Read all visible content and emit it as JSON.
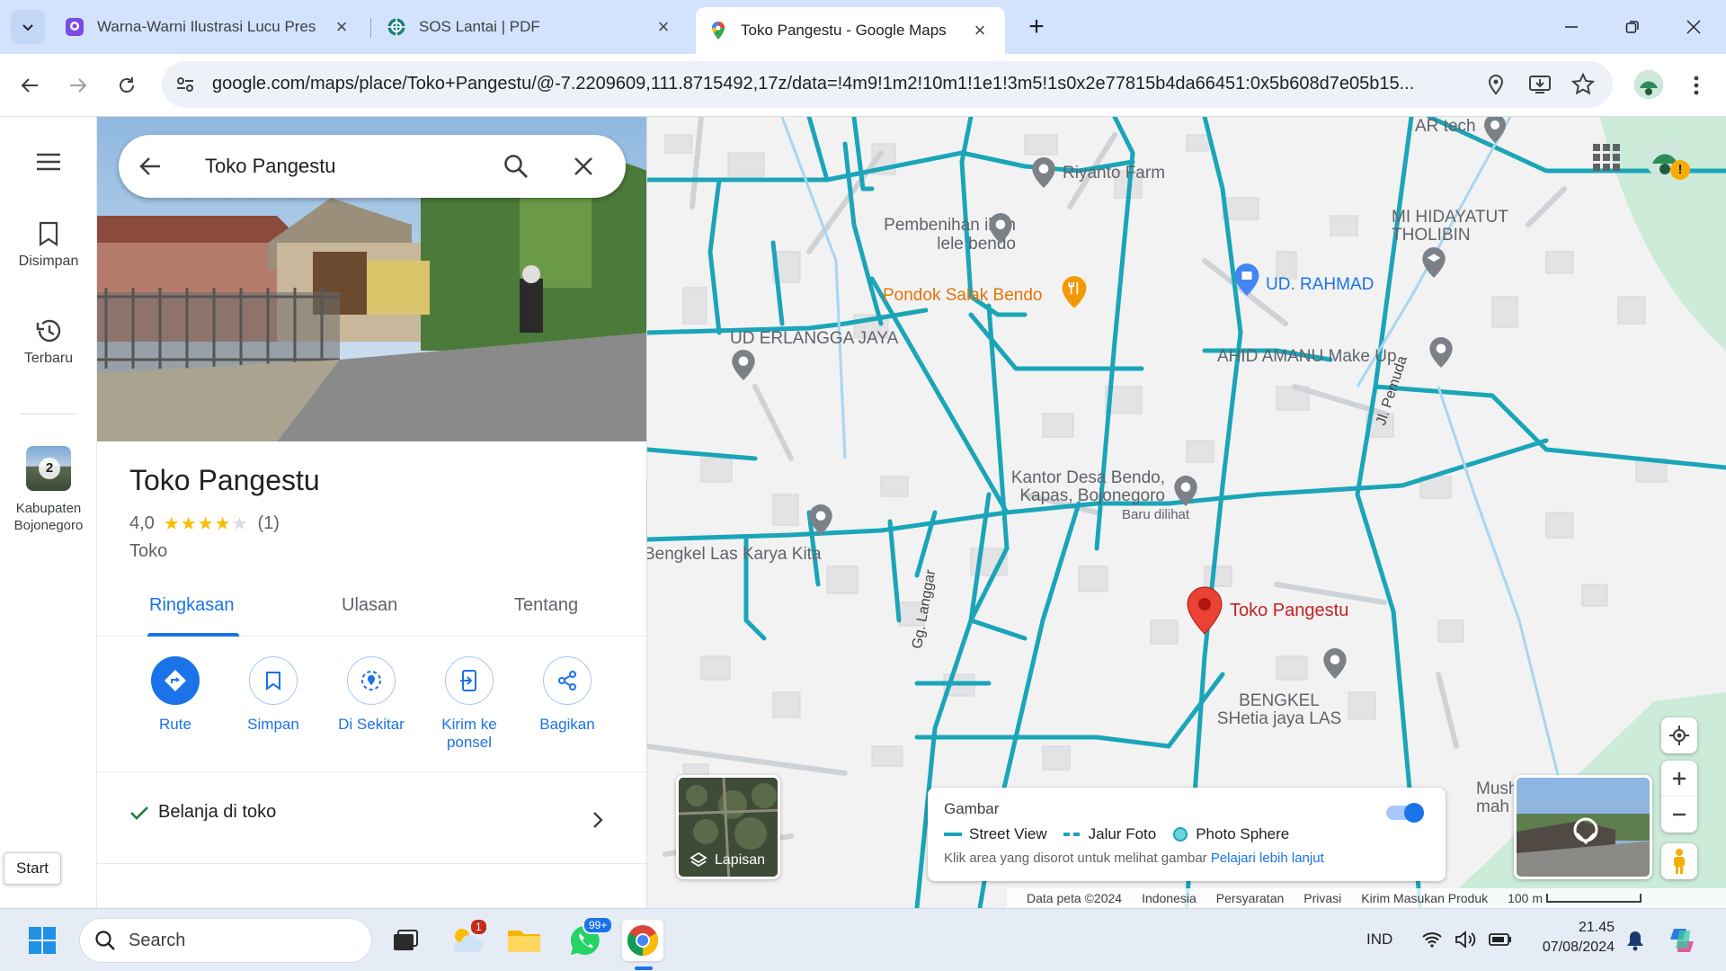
{
  "browser": {
    "tabs": [
      {
        "title": "Warna-Warni Ilustrasi Lucu Pres",
        "icon": "canva-icon"
      },
      {
        "title": "SOS Lantai | PDF",
        "icon": "globe-icon"
      },
      {
        "title": "Toko Pangestu - Google Maps",
        "icon": "maps-pin-icon",
        "active": true
      }
    ],
    "new_tab": "+",
    "url": "google.com/maps/place/Toko+Pangestu/@-7.2209609,111.8715492,17z/data=!4m9!1m2!10m1!1e1!3m5!1s0x2e77815b4da66451:0x5b608d7e05b15..."
  },
  "rail": {
    "saved": "Disimpan",
    "recent": "Terbaru",
    "recent_place": "Kabupaten Bojonegoro",
    "recent_count": "2"
  },
  "search": {
    "value": "Toko Pangestu"
  },
  "place": {
    "name": "Toko Pangestu",
    "rating": "4,0",
    "stars": 4,
    "reviews": "(1)",
    "category": "Toko"
  },
  "panel_tabs": [
    "Ringkasan",
    "Ulasan",
    "Tentang"
  ],
  "actions": [
    {
      "label": "Rute"
    },
    {
      "label": "Simpan"
    },
    {
      "label": "Di Sekitar"
    },
    {
      "label": "Kirim ke ponsel"
    },
    {
      "label": "Bagikan"
    }
  ],
  "service": "Belanja di toko",
  "map": {
    "labels": {
      "artech": "AR tech",
      "riyanto": "Riyanto Farm",
      "pembenihan": "Pembenihan ikan lele bendo",
      "mi": "MI HIDAYATUT THOLIBIN",
      "pondok": "Pondok Salak Bendo",
      "udrahmad": "UD. RAHMAD",
      "uderlangga": "UD ERLANGGA JAYA",
      "ahid": "AHID AMANU Make Up",
      "pemuda": "Jl. Pemuda",
      "kantor": "Kantor Desa Bendo, Kapas, Bojonegoro",
      "baru": "Baru dilihat",
      "bengkellas": "Bengkel Las Karya Kita",
      "langgar": "Gg. Langgar",
      "selected": "Toko Pangestu",
      "bengkel": "BENGKEL SHetia jaya LAS",
      "musholla": "Musholla Nu mah Ben"
    },
    "layers": "Lapisan",
    "imagery": {
      "title": "Gambar",
      "legend": [
        "Street View",
        "Jalur Foto",
        "Photo Sphere"
      ],
      "hint": "Klik area yang disorot untuk melihat gambar",
      "link": "Pelajari lebih lanjut",
      "toggle_on": true
    },
    "footer": [
      "Data peta ©2024",
      "Indonesia",
      "Persyaratan",
      "Privasi",
      "Kirim Masukan Produk",
      "100 m"
    ],
    "colors": {
      "streetview": "#1aa5b8",
      "pin": "#ea4335",
      "accent": "#1a73e8"
    }
  },
  "tooltip": "Start",
  "taskbar": {
    "search_placeholder": "Search",
    "weather_badge": "1",
    "whatsapp_badge": "99+",
    "lang": "IND",
    "time": "21.45",
    "date": "07/08/2024"
  }
}
